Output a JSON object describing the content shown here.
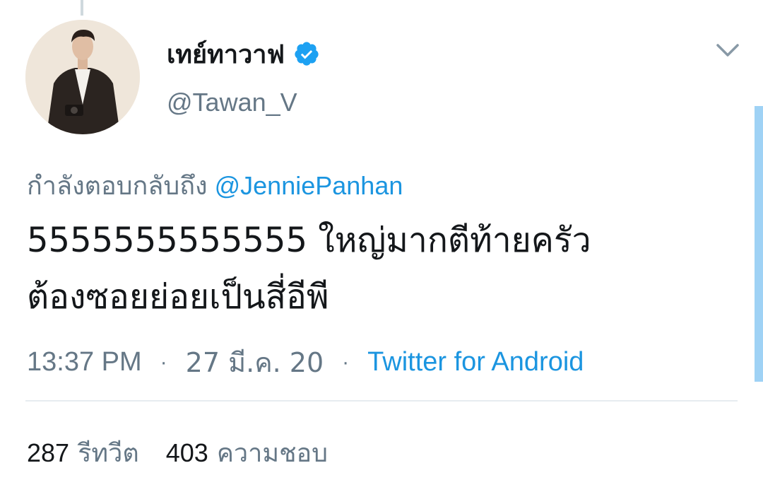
{
  "author": {
    "display_name": "เทย์ทาวาฟ",
    "username": "@Tawan_V",
    "verified_icon": "verified-badge-icon",
    "avatar_icon": "profile-photo"
  },
  "reply": {
    "prefix": "กำลังตอบกลับถึง",
    "mention": "@JenniePanhan"
  },
  "tweet": {
    "line1": "5555555555555 ใหญ่มากตีท้ายครัว",
    "line2": "ต้องซอยย่อยเป็นสี่อีพี"
  },
  "meta": {
    "time": "13:37 PM",
    "separator": "·",
    "date": "27 มี.ค. 20",
    "source": "Twitter for Android"
  },
  "stats": {
    "retweets_count": "287",
    "retweets_label": "รีทวีต",
    "likes_count": "403",
    "likes_label": "ความชอบ"
  },
  "colors": {
    "link": "#1b95e0",
    "secondary_text": "#657786",
    "primary_text": "#14171a",
    "verified": "#1da1f2"
  }
}
